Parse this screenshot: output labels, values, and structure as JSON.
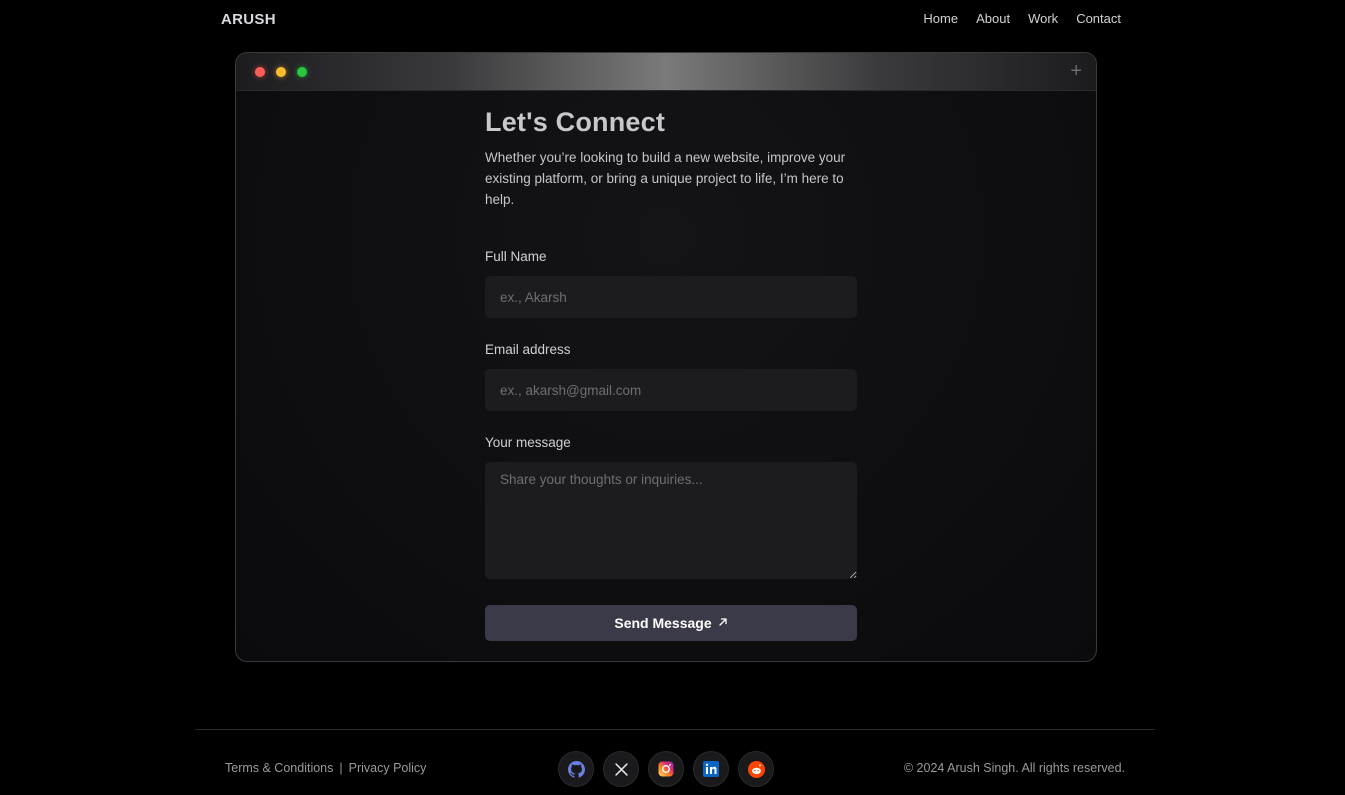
{
  "header": {
    "logo": "ARUSH",
    "nav": [
      "Home",
      "About",
      "Work",
      "Contact"
    ]
  },
  "window": {
    "plus_icon": "plus-icon"
  },
  "contact": {
    "title": "Let's Connect",
    "intro": "Whether you’re looking to build a new website, improve your existing platform, or bring a unique project to life, I’m here to help.",
    "name_label": "Full Name",
    "name_placeholder": "ex., Akarsh",
    "email_label": "Email address",
    "email_placeholder": "ex., akarsh@gmail.com",
    "message_label": "Your message",
    "message_placeholder": "Share your thoughts or inquiries...",
    "send_label": "Send Message",
    "send_icon": "arrow-up-right-icon"
  },
  "footer": {
    "terms": "Terms & Conditions",
    "separator": "|",
    "privacy": "Privacy Policy",
    "socials": [
      "github-icon",
      "x-icon",
      "instagram-icon",
      "linkedin-icon",
      "reddit-icon"
    ],
    "copyright": "© 2024 Arush Singh. All rights reserved."
  },
  "colors": {
    "background": "#000000",
    "panel": "#0e0e10",
    "input": "#1c1c1f",
    "button": "#3b3a48"
  }
}
